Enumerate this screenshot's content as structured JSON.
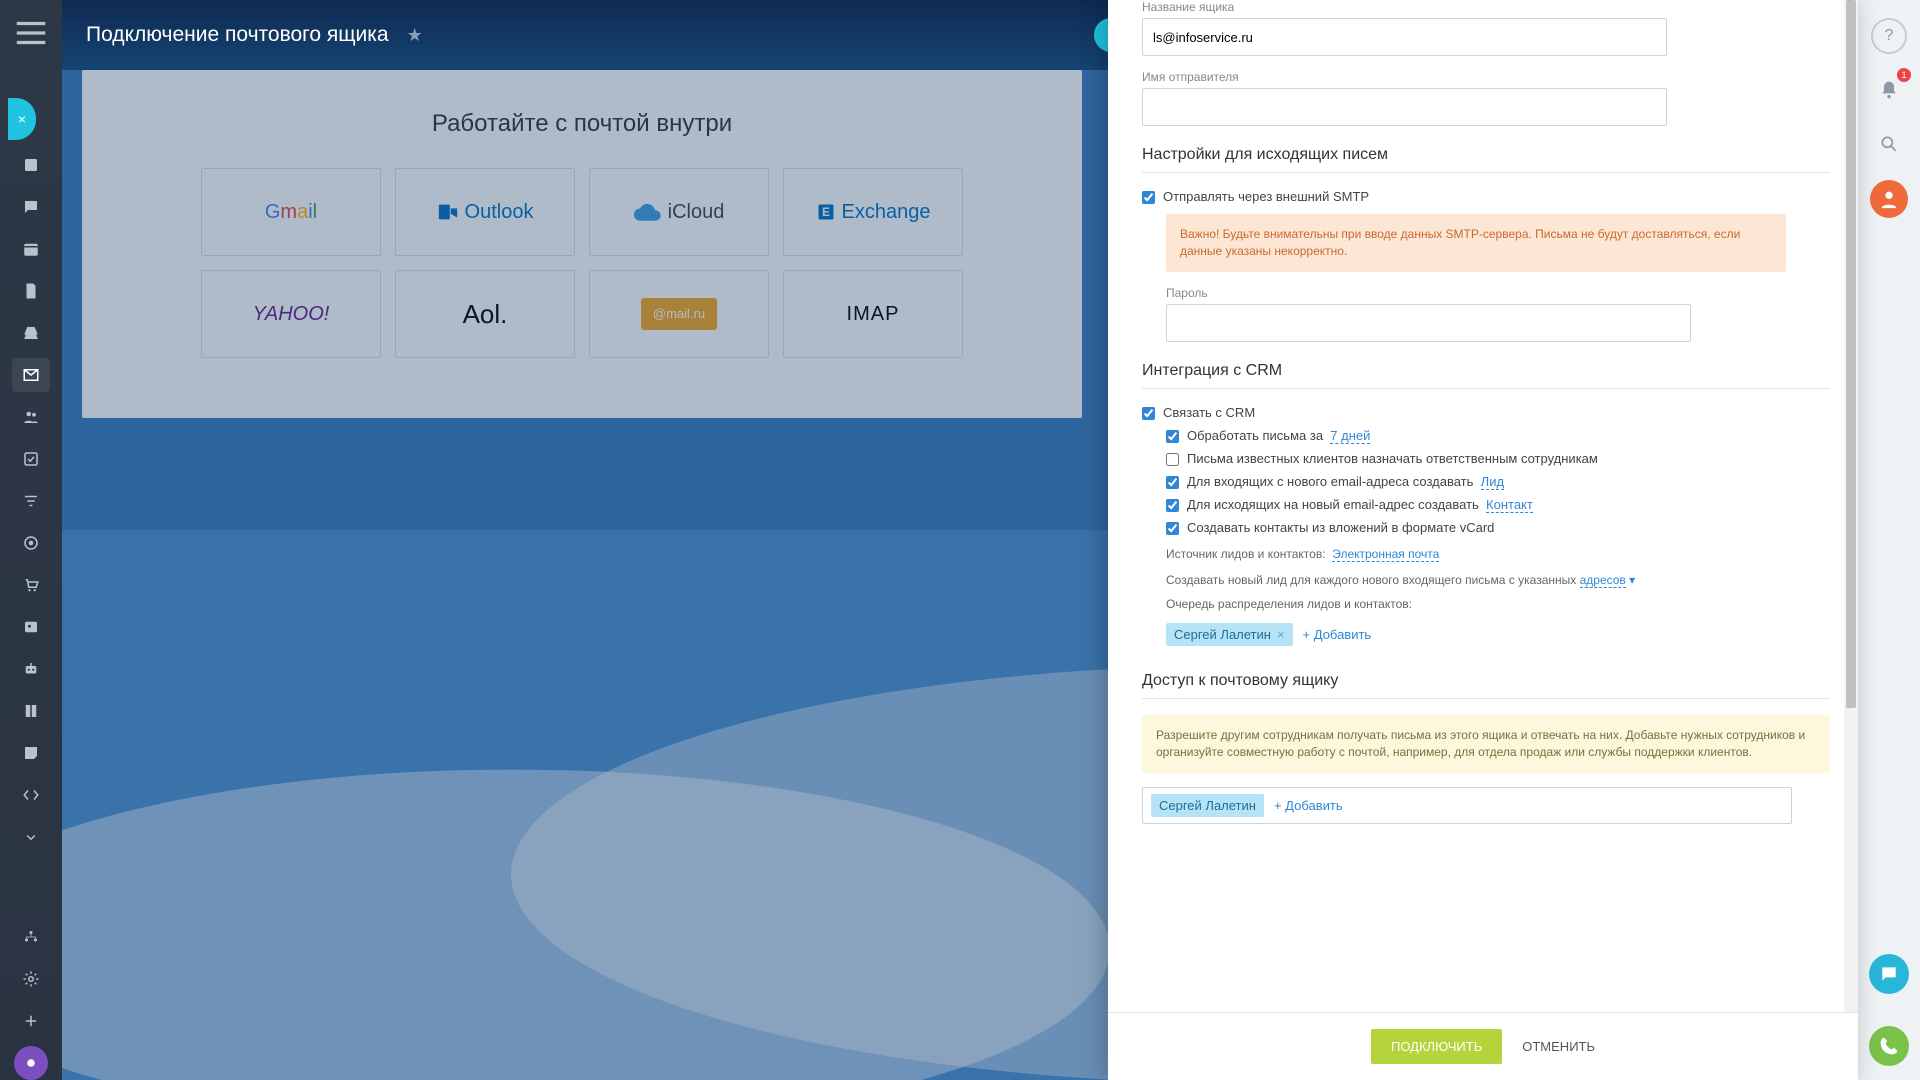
{
  "header": {
    "title": "Подключение почтового ящика"
  },
  "card": {
    "heading": "Работайте с почтой внутри"
  },
  "providers": {
    "gmail": "Gmail",
    "outlook": "Outlook",
    "icloud": "iCloud",
    "exchange": "Exchange",
    "yahoo": "YAHOO!",
    "aol": "Aol.",
    "mailru": "@mail.ru",
    "imap": "IMAP"
  },
  "panel": {
    "mailbox_name_label": "Название ящика",
    "mailbox_name_value": "ls@infoservice.ru",
    "sender_name_label": "Имя отправителя",
    "sender_name_value": "",
    "section_outgoing": "Настройки для исходящих писем",
    "send_via_smtp": "Отправлять через внешний SMTP",
    "smtp_warning": "Важно! Будьте внимательны при вводе данных SMTP-сервера. Письма не будут доставляться, если данные указаны некорректно.",
    "password_label": "Пароль",
    "section_crm": "Интеграция с CRM",
    "link_crm": "Связать с CRM",
    "process_for_prefix": "Обработать письма за",
    "process_for_value": "7 дней",
    "known_clients": "Письма известных клиентов назначать ответственным сотрудникам",
    "incoming_new_prefix": "Для входящих с нового email-адреса создавать",
    "incoming_new_value": "Лид",
    "outgoing_new_prefix": "Для исходящих на новый email-адрес создавать",
    "outgoing_new_value": "Контакт",
    "vcard": "Создавать контакты из вложений в формате vCard",
    "source_prefix": "Источник лидов и контактов:",
    "source_value": "Электронная почта",
    "new_lead_prefix": "Создавать новый лид для каждого нового входящего письма с указанных",
    "new_lead_link": "адресов",
    "queue_label": "Очередь распределения лидов и контактов:",
    "queue_user": "Сергей Лалетин",
    "add_label": "+ Добавить",
    "section_access": "Доступ к почтовому ящику",
    "access_info": "Разрешите другим сотрудникам получать письма из этого ящика и отвечать на них. Добавьте нужных сотрудников и организуйте совместную работу с почтой, например, для отдела продаж или службы поддержки клиентов.",
    "access_user": "Сергей Лалетин"
  },
  "footer": {
    "submit": "ПОДКЛЮЧИТЬ",
    "cancel": "ОТМЕНИТЬ"
  },
  "right_rail": {
    "badge": "1"
  }
}
